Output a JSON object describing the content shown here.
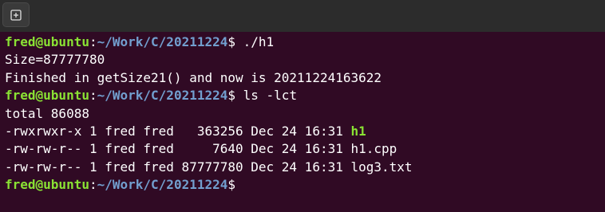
{
  "window": {
    "new_tab_icon": "plus-in-square-icon"
  },
  "prompt": {
    "user_host": "fred@ubuntu",
    "colon": ":",
    "path": "~/Work/C/20211224",
    "symbol": "$ "
  },
  "lines": [
    {
      "type": "prompt",
      "command": "./h1"
    },
    {
      "type": "output",
      "text": "Size=87777780"
    },
    {
      "type": "output",
      "text": "Finished in getSize21() and now is 20211224163622"
    },
    {
      "type": "prompt",
      "command": "ls -lct"
    },
    {
      "type": "output",
      "text": "total 86088"
    },
    {
      "type": "listing",
      "meta": "-rwxrwxr-x 1 fred fred   363256 Dec 24 16:31 ",
      "name": "h1",
      "executable": true
    },
    {
      "type": "listing",
      "meta": "-rw-rw-r-- 1 fred fred     7640 Dec 24 16:31 ",
      "name": "h1.cpp",
      "executable": false
    },
    {
      "type": "listing",
      "meta": "-rw-rw-r-- 1 fred fred 87777780 Dec 24 16:31 ",
      "name": "log3.txt",
      "executable": false
    },
    {
      "type": "prompt",
      "command": ""
    }
  ],
  "colors": {
    "background": "#300a24",
    "user_host": "#8ae234",
    "path": "#729fcf",
    "executable": "#8ae234",
    "text": "#ffffff"
  }
}
